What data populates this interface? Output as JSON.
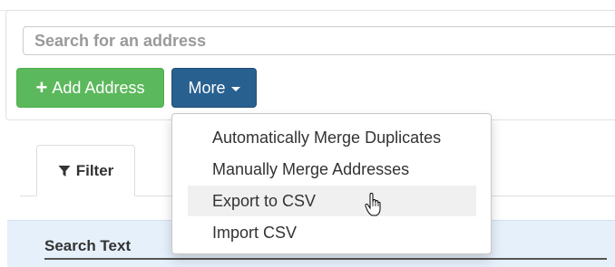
{
  "search": {
    "placeholder": "Search for an address",
    "value": ""
  },
  "toolbar": {
    "add_label": "Add Address",
    "add_icon": "plus-icon",
    "more_label": "More",
    "more_icon": "caret-down-icon"
  },
  "dropdown": {
    "items": [
      {
        "label": "Automatically Merge Duplicates"
      },
      {
        "label": "Manually Merge Addresses"
      },
      {
        "label": "Export to CSV",
        "hovered": true
      },
      {
        "label": "Import CSV"
      }
    ]
  },
  "tabs": [
    {
      "label": "Filter",
      "icon": "filter-icon",
      "active": true
    }
  ],
  "filter_panel": {
    "search_text_label": "Search Text"
  },
  "colors": {
    "success": "#5cb85c",
    "primary": "#286090",
    "filter_bg": "#e6f0fb",
    "hover_bg": "#f0f0f0"
  },
  "cursor": "hand-pointer-icon"
}
